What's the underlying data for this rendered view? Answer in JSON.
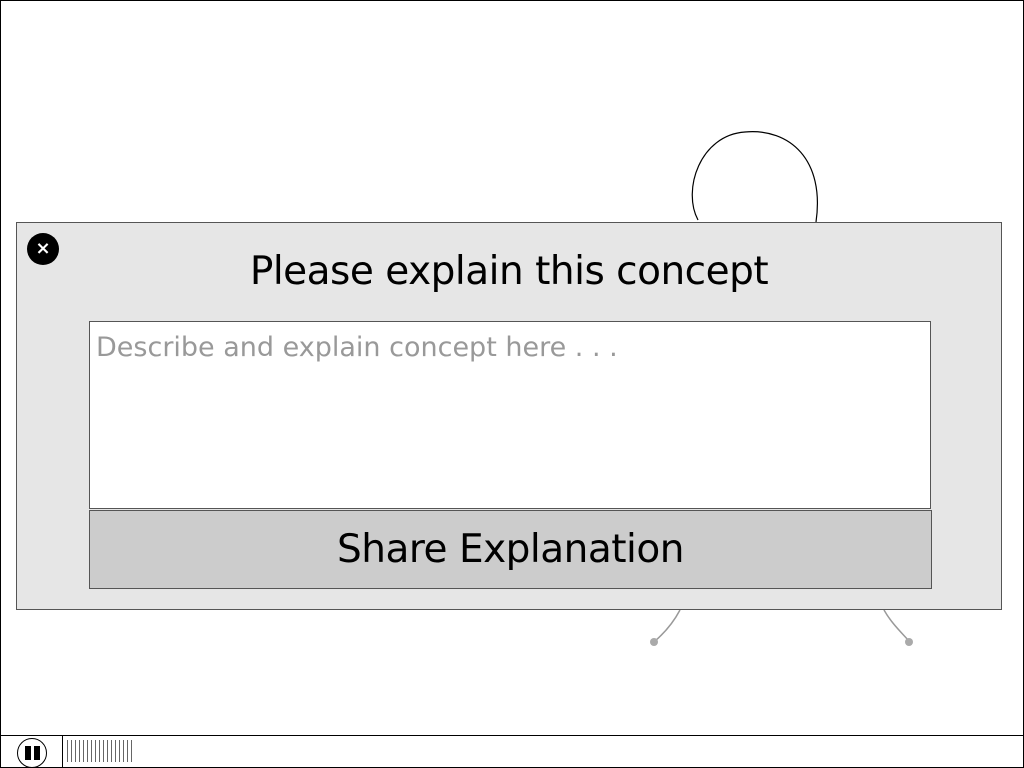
{
  "modal": {
    "close_label": "×",
    "title": "Please explain this concept",
    "input_value": "",
    "input_placeholder": "Describe and explain concept here . . .",
    "submit_label": "Share Explanation"
  },
  "playback": {
    "state": "playing",
    "progress_fraction": 0.07
  },
  "colors": {
    "modal_bg": "#e6e6e6",
    "button_bg": "#cccccc",
    "placeholder": "#999999"
  },
  "icons": {
    "close": "close-icon",
    "pause": "pause-icon",
    "figure": "stick-figure-sketch"
  }
}
